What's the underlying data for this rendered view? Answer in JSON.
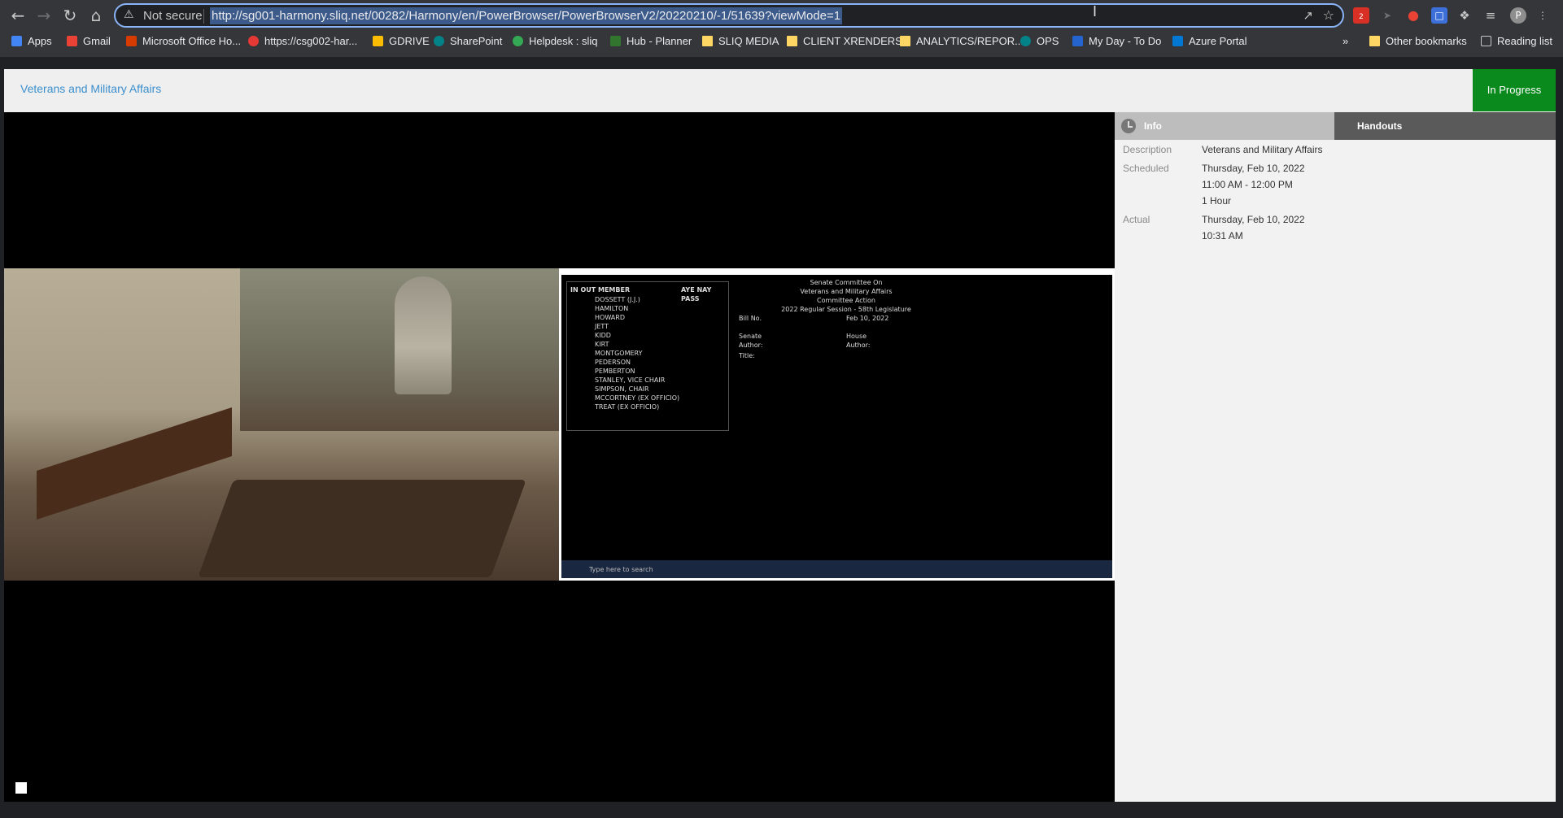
{
  "browser": {
    "security_label": "Not secure",
    "url": "http://sg001-harmony.sliq.net/00282/Harmony/en/PowerBrowser/PowerBrowserV2/20220210/-1/51639?viewMode=1",
    "bookmarks": [
      {
        "label": "Apps",
        "icon": "apps-grid-icon"
      },
      {
        "label": "Gmail",
        "icon": "gmail-icon"
      },
      {
        "label": "Microsoft Office Ho...",
        "icon": "office-icon"
      },
      {
        "label": "https://csg002-har...",
        "icon": "red-circle-icon"
      },
      {
        "label": "GDRIVE",
        "icon": "drive-icon"
      },
      {
        "label": "SharePoint",
        "icon": "sharepoint-icon"
      },
      {
        "label": "Helpdesk : sliq",
        "icon": "helpdesk-icon"
      },
      {
        "label": "Hub - Planner",
        "icon": "planner-icon"
      },
      {
        "label": "SLIQ MEDIA",
        "icon": "folder-icon"
      },
      {
        "label": "CLIENT XRENDERS",
        "icon": "folder-icon"
      },
      {
        "label": "ANALYTICS/REPOR...",
        "icon": "folder-icon"
      },
      {
        "label": "OPS",
        "icon": "sharepoint-icon"
      },
      {
        "label": "My Day - To Do",
        "icon": "todo-check-icon"
      },
      {
        "label": "Azure Portal",
        "icon": "azure-icon"
      }
    ],
    "overflow": "»",
    "other_bookmarks": "Other bookmarks",
    "reading_list": "Reading list",
    "profile_initial": "P",
    "extension_badge": "2"
  },
  "header": {
    "title": "Veterans and Military Affairs",
    "status": "In Progress"
  },
  "video_screen": {
    "vote_header": "IN OUT MEMBER",
    "vote_cols": "AYE NAY PASS",
    "members": [
      "DOSSETT (J.J.)",
      "HAMILTON",
      "HOWARD",
      "JETT",
      "KIDD",
      "KIRT",
      "MONTGOMERY",
      "PEDERSON",
      "PEMBERTON",
      "STANLEY, VICE CHAIR",
      "SIMPSON, CHAIR",
      "MCCORTNEY (EX OFFICIO)",
      "TREAT (EX OFFICIO)"
    ],
    "committee_lines": [
      "Senate Committee On",
      "Veterans and Military Affairs",
      "Committee Action",
      "2022 Regular Session - 58th Legislature"
    ],
    "bill_label": "Bill No.",
    "date": "Feb 10, 2022",
    "senate_author": "Senate Author:",
    "house_author": "House Author:",
    "title_label": "Title:",
    "taskbar_search": "Type here to search"
  },
  "panel": {
    "tabs": {
      "info": "Info",
      "handouts": "Handouts"
    },
    "description_label": "Description",
    "description_value": "Veterans and Military Affairs",
    "scheduled_label": "Scheduled",
    "scheduled_date": "Thursday, Feb 10, 2022",
    "scheduled_time": "11:00 AM - 12:00 PM",
    "scheduled_duration": "1 Hour",
    "actual_label": "Actual",
    "actual_date": "Thursday, Feb 10, 2022",
    "actual_time": "10:31 AM"
  }
}
